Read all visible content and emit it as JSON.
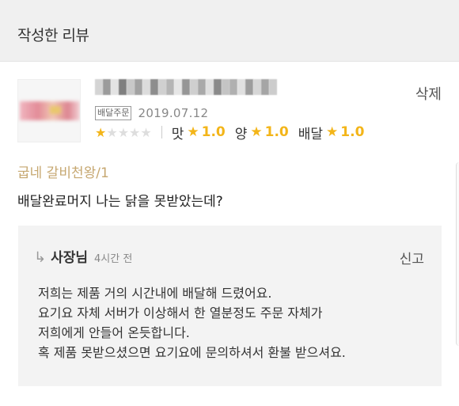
{
  "header": {
    "title": "작성한 리뷰"
  },
  "review": {
    "delete_label": "삭제",
    "order_badge": "배달주문",
    "date": "2019.07.12",
    "overall_stars": 1,
    "max_stars": 5,
    "ratings": [
      {
        "label": "맛",
        "value": "1.0"
      },
      {
        "label": "양",
        "value": "1.0"
      },
      {
        "label": "배달",
        "value": "1.0"
      }
    ],
    "menu": "굽네 갈비천왕/1",
    "text": "배달완료머지 나는 닭을 못받았는데?"
  },
  "reply": {
    "owner_label": "사장님",
    "time": "4시간 전",
    "report_label": "신고",
    "lines": [
      "저희는 제품 거의 시간내에 배달해 드렸어요.",
      "요기요 자체 서버가 이상해서 한 열분정도 주문 자체가",
      "저희에게 안들어 온듯합니다.",
      "혹 제품 못받으셨으면 요기요에 문의하셔서 환불 받으셔요."
    ]
  },
  "icons": {
    "reply_arrow": "reply-arrow-icon",
    "star": "star-icon"
  },
  "colors": {
    "accent_star": "#f3b519",
    "menu_text": "#c6a770",
    "reply_bg": "#f3f3f3",
    "header_bg": "#f0f0f0"
  }
}
